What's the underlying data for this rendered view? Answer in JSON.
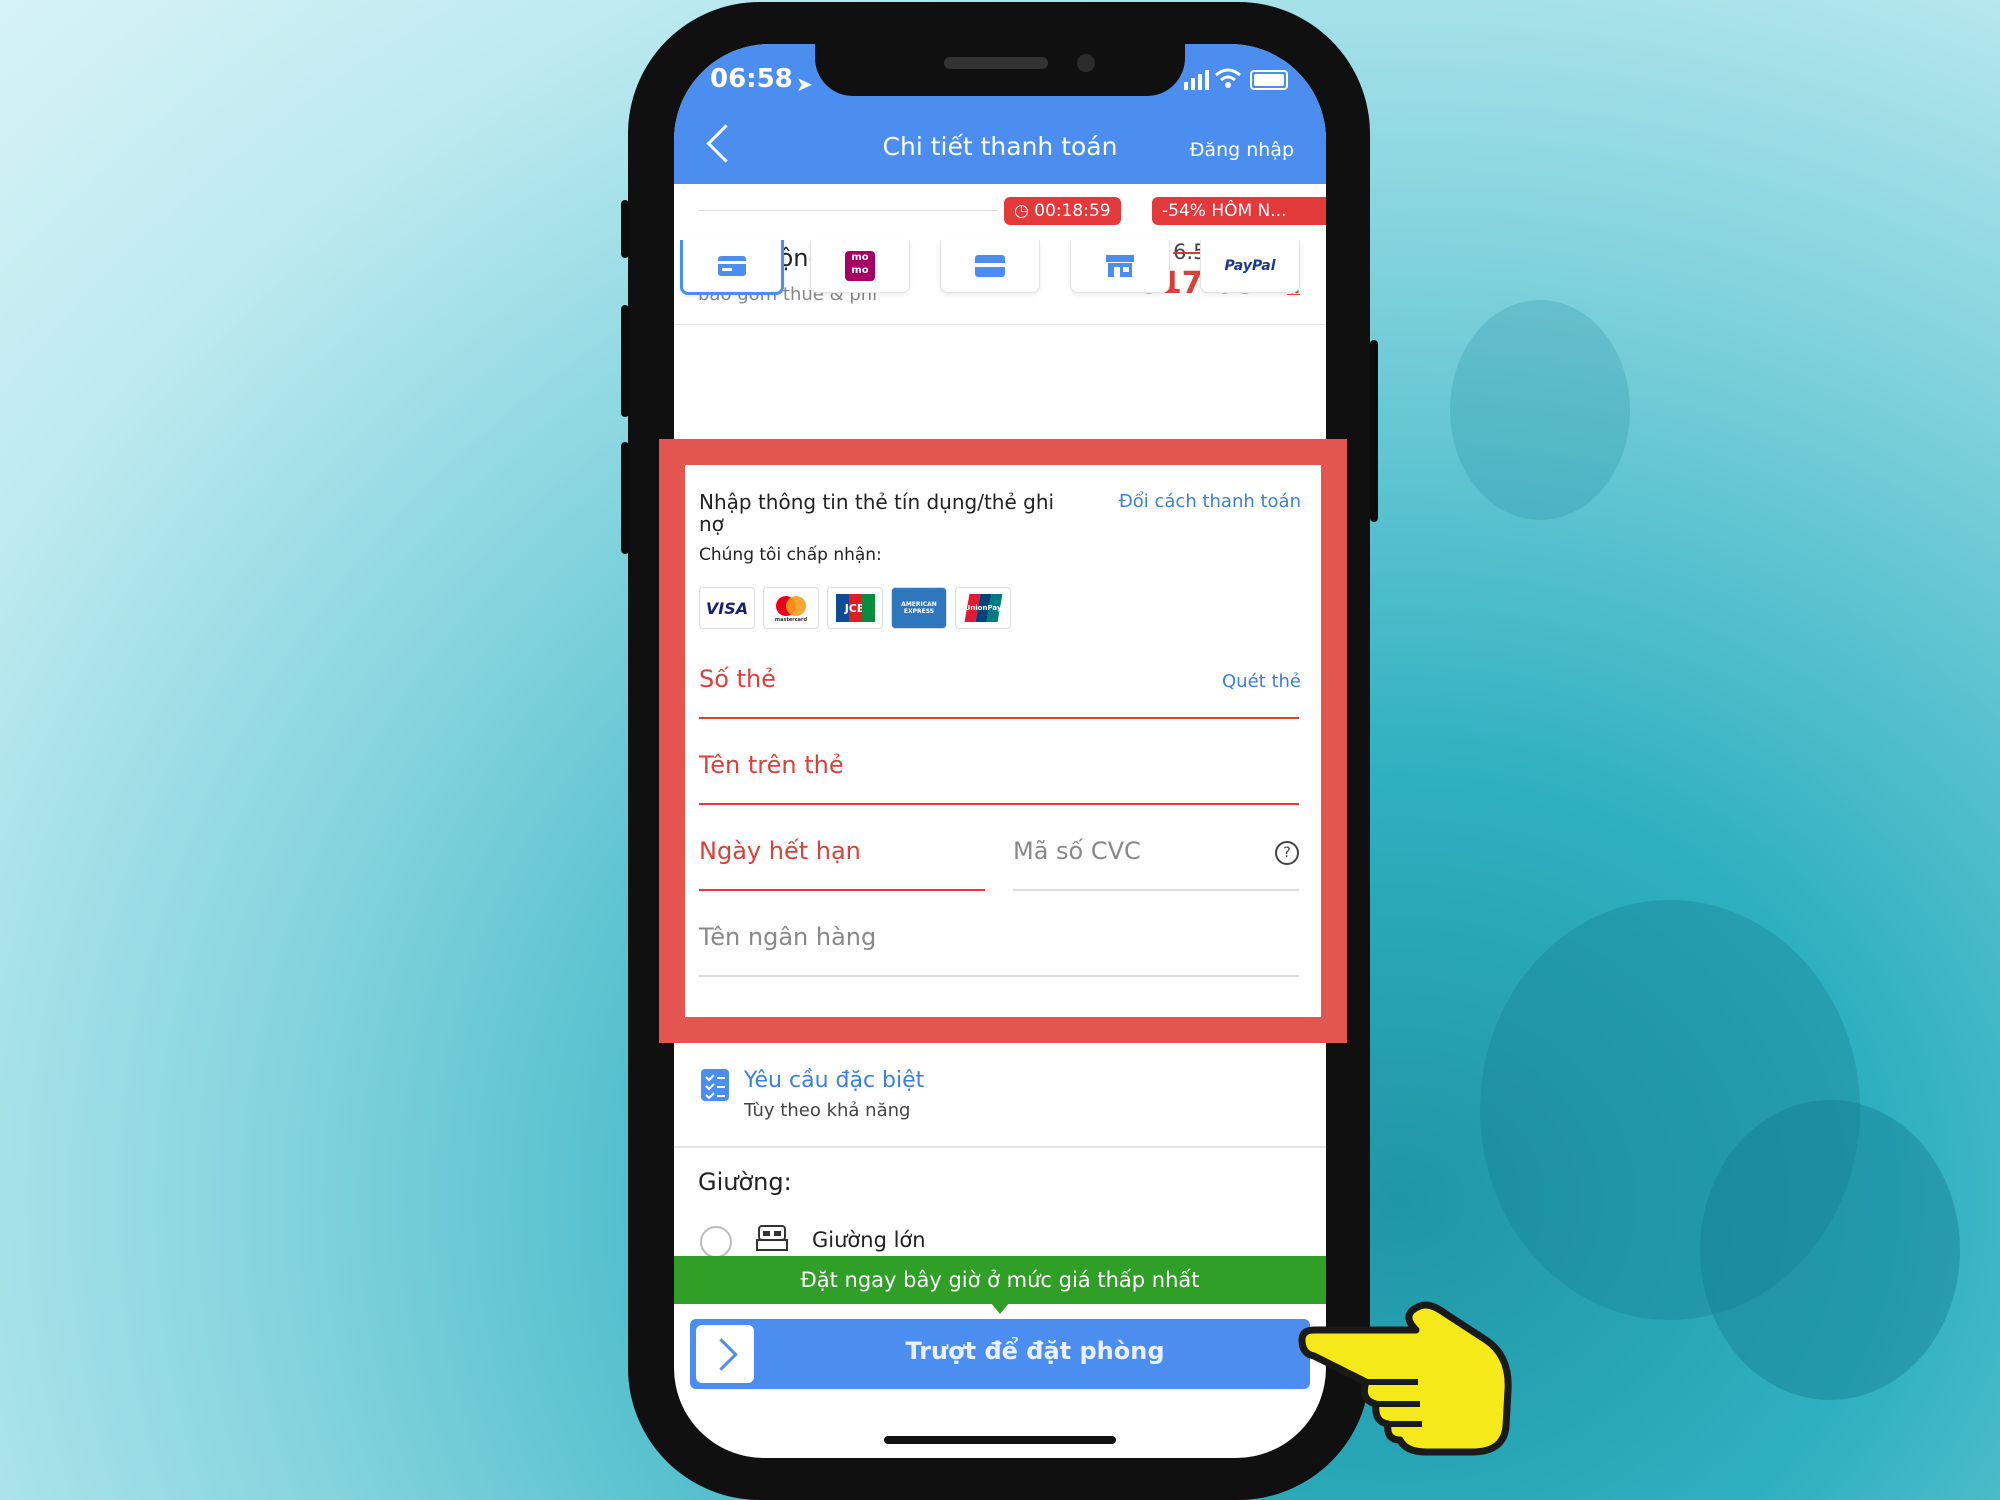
{
  "status": {
    "time": "06:58"
  },
  "header": {
    "title": "Chi tiết thanh toán",
    "login": "Đăng nhập"
  },
  "promo": {
    "timer": "00:18:59",
    "discount": "-54% HÔM N..."
  },
  "total": {
    "label": "Tổng cộng",
    "subtext": "bao gồm thuế & phí",
    "old_price": "6.570.231 đ",
    "new_price": "2.917.687",
    "currency": "đ"
  },
  "payment_methods": [
    "credit-card-icon",
    "momo-icon",
    "bank-card-icon",
    "store-icon",
    "PayPal"
  ],
  "card_form": {
    "heading": "Nhập thông tin thẻ tín dụng/thẻ ghi nợ",
    "change_method": "Đổi cách thanh toán",
    "accept_label": "Chúng tôi chấp nhận:",
    "accepted_cards": [
      "VISA",
      "mastercard",
      "JCB",
      "AMERICAN EXPRESS",
      "UnionPay"
    ],
    "card_number": "Số thẻ",
    "scan_card": "Quét thẻ",
    "name_on_card": "Tên trên thẻ",
    "expiry": "Ngày hết hạn",
    "cvc": "Mã số CVC",
    "bank_name": "Tên ngân hàng"
  },
  "special_request": {
    "title": "Yêu cầu đặc biệt",
    "subtitle": "Tùy theo khả năng"
  },
  "bed": {
    "label": "Giường:",
    "option": "Giường lớn"
  },
  "banner": "Đặt ngay bây giờ ở mức giá thấp nhất",
  "slide_button": "Trượt để đặt phòng",
  "colors": {
    "primary": "#4b8ef0",
    "error": "#d9413a",
    "highlight": "#e3564f",
    "banner": "#2f9f27",
    "hand": "#f5e91a"
  }
}
